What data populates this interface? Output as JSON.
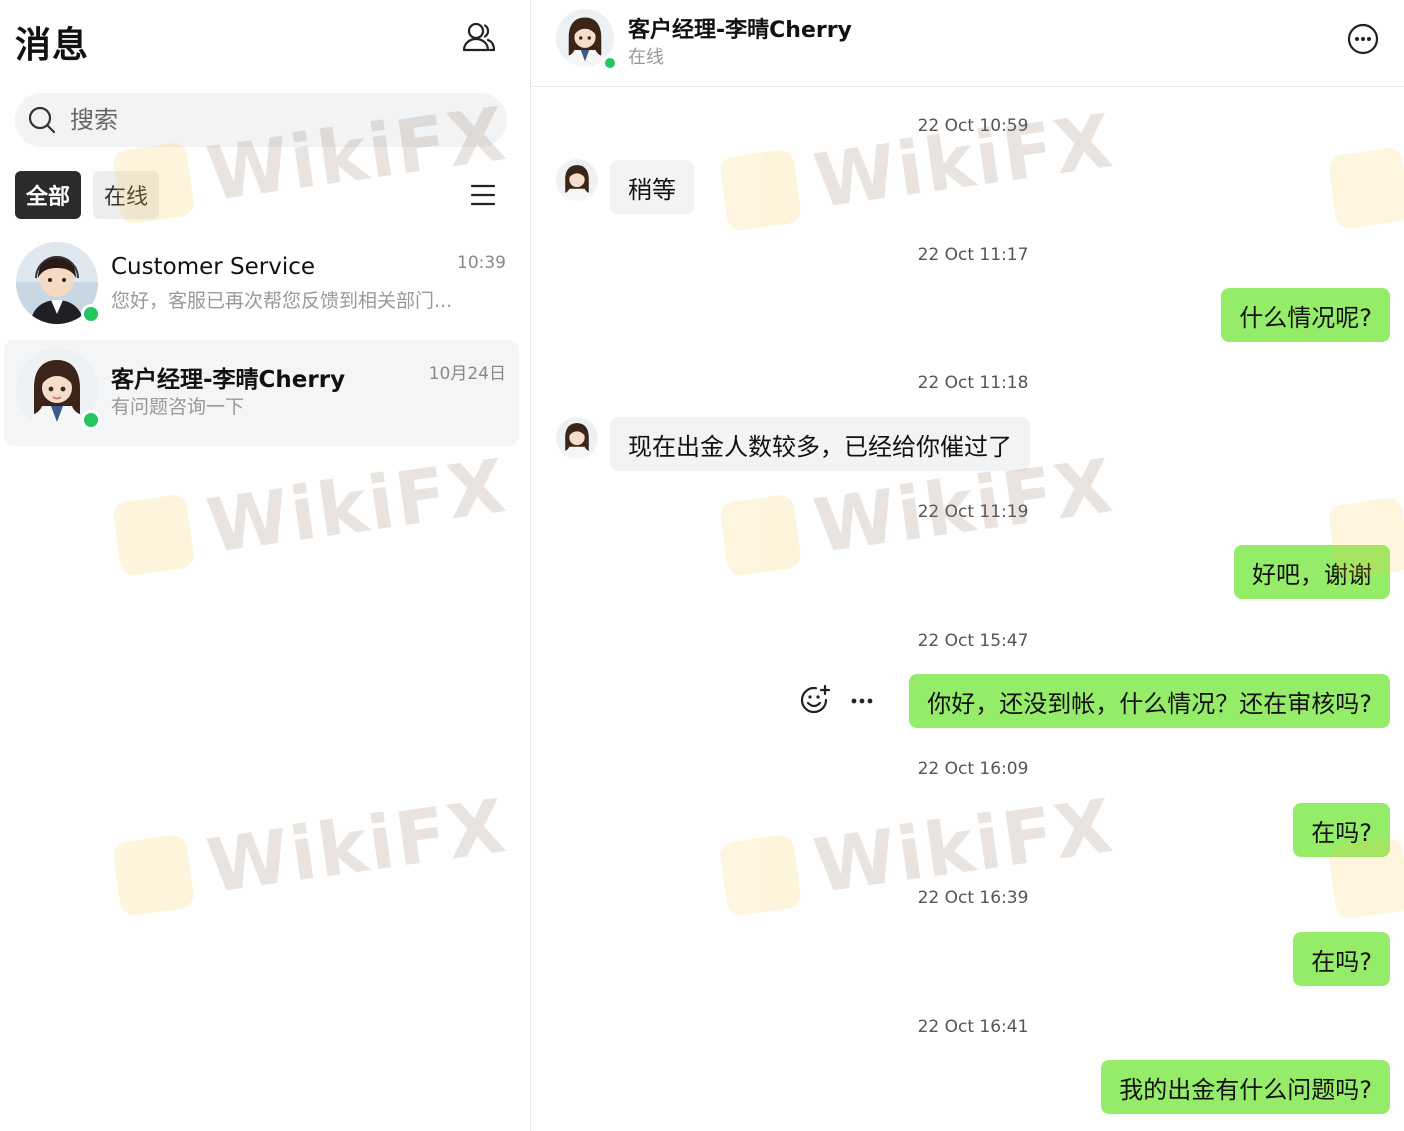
{
  "sidebar": {
    "title": "消息",
    "search_placeholder": "搜索",
    "tabs": {
      "all": "全部",
      "online": "在线"
    },
    "chats": [
      {
        "name": "Customer Service",
        "time": "10:39",
        "preview": "您好，客服已再次帮您反馈到相关部门...",
        "online": true
      },
      {
        "name": "客户经理-李晴Cherry",
        "time": "10月24日",
        "preview": "有问题咨询一下",
        "online": true
      }
    ]
  },
  "conversation": {
    "name": "客户经理-李晴Cherry",
    "status": "在线",
    "messages": [
      {
        "time": "22 Oct 10:59",
        "direction": "in",
        "text": "稍等"
      },
      {
        "time": "22 Oct 11:17",
        "direction": "out",
        "text": "什么情况呢?"
      },
      {
        "time": "22 Oct 11:18",
        "direction": "in",
        "text": "现在出金人数较多，已经给你催过了"
      },
      {
        "time": "22 Oct 11:19",
        "direction": "out",
        "text": "好吧，谢谢"
      },
      {
        "time": "22 Oct 15:47",
        "direction": "out",
        "text": "你好，还没到帐，什么情况？还在审核吗?"
      },
      {
        "time": "22 Oct 16:09",
        "direction": "out",
        "text": "在吗?"
      },
      {
        "time": "22 Oct 16:39",
        "direction": "out",
        "text": "在吗?"
      },
      {
        "time": "22 Oct 16:41",
        "direction": "out",
        "text": "我的出金有什么问题吗?"
      }
    ]
  },
  "colors": {
    "out_bubble": "#95ec69",
    "in_bubble": "#f2f3f5",
    "online_dot": "#22c55e",
    "active_tab": "#2b2b2b"
  },
  "icons": [
    "user-contacts-icon",
    "search-icon",
    "menu-icon",
    "more-options-icon",
    "emoji-reaction-icon",
    "more-dots-icon"
  ],
  "watermark": "WikiFX"
}
